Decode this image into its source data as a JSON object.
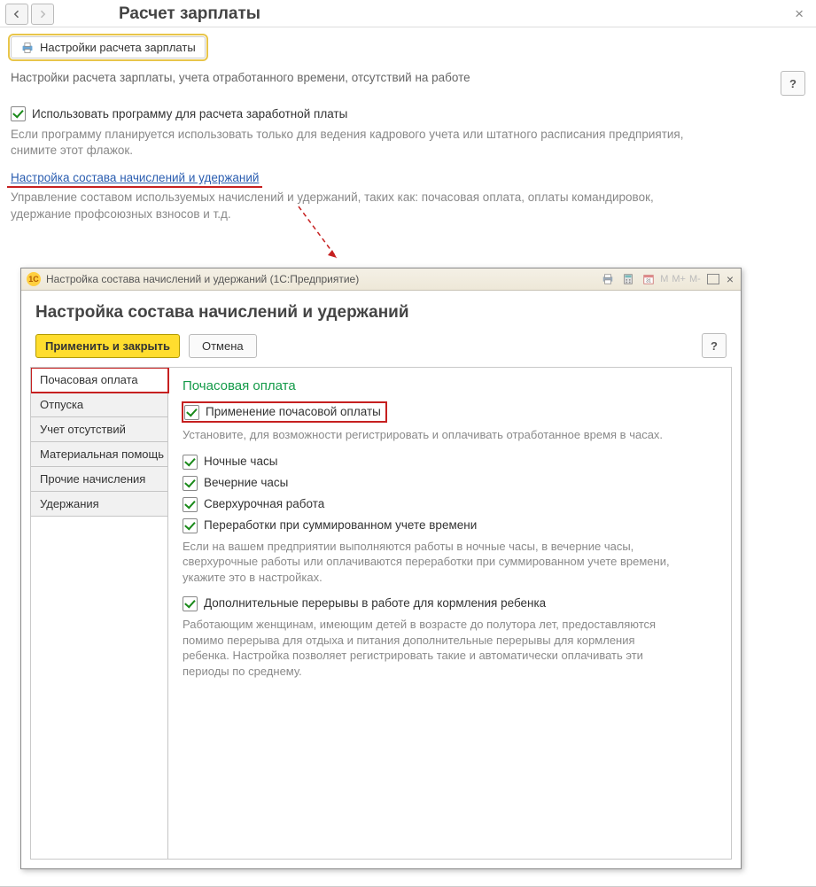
{
  "header": {
    "title": "Расчет зарплаты"
  },
  "toolbar": {
    "settings_button": "Настройки расчета зарплаты"
  },
  "intro": "Настройки расчета зарплаты, учета отработанного времени, отсутствий на работе",
  "main_check": {
    "label": "Использовать программу для расчета заработной платы",
    "checked": true
  },
  "main_hint": "Если программу планируется использовать только для ведения кадрового учета или штатного расписания предприятия, снимите этот флажок.",
  "link": "Настройка состава начислений и удержаний",
  "link_hint": "Управление составом используемых начислений и удержаний, таких как: почасовая оплата, оплаты командировок, удержание профсоюзных взносов и т.д.",
  "dialog": {
    "titlebar": "Настройка состава начислений и удержаний  (1С:Предприятие)",
    "icon": "1C",
    "m_labels": [
      "M",
      "M+",
      "M-"
    ],
    "heading": "Настройка состава начислений и удержаний",
    "apply": "Применить и закрыть",
    "cancel": "Отмена",
    "tabs": [
      "Почасовая оплата",
      "Отпуска",
      "Учет отсутствий",
      "Материальная помощь",
      "Прочие начисления",
      "Удержания"
    ],
    "active_tab": 0,
    "content": {
      "section_title": "Почасовая оплата",
      "c1": {
        "label": "Применение почасовой оплаты",
        "checked": true
      },
      "c1_desc": "Установите, для возможности регистрировать и оплачивать отработанное время в часах.",
      "c2": {
        "label": "Ночные часы",
        "checked": true
      },
      "c3": {
        "label": "Вечерние часы",
        "checked": true
      },
      "c4": {
        "label": "Сверхурочная работа",
        "checked": true
      },
      "c5": {
        "label": "Переработки при суммированном учете времени",
        "checked": true
      },
      "c5_desc": "Если на вашем предприятии выполняются работы в ночные часы, в вечерние часы, сверхурочные работы или оплачиваются переработки при суммированном учете времени, укажите это в настройках.",
      "c6": {
        "label": "Дополнительные перерывы в работе для кормления ребенка",
        "checked": true
      },
      "c6_desc": "Работающим женщинам, имеющим детей в возрасте до полутора лет, предоставляются помимо перерыва для отдыха и питания дополнительные перерывы для кормления ребенка. Настройка позволяет регистрировать такие и автоматически оплачивать эти периоды по среднему."
    }
  }
}
